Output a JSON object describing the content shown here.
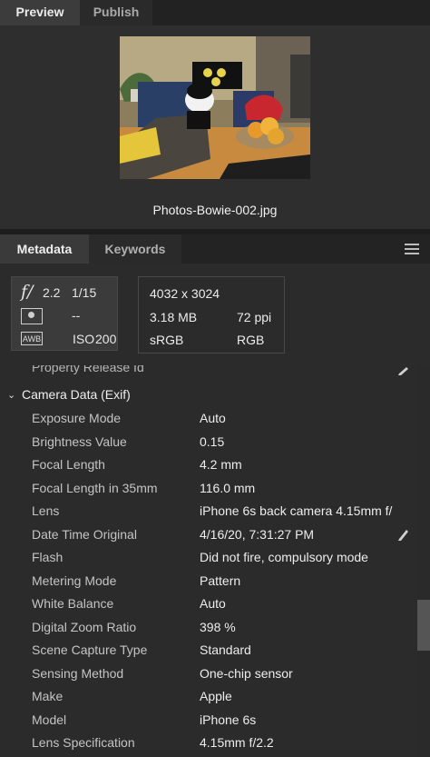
{
  "top_tabs": {
    "preview": "Preview",
    "publish": "Publish"
  },
  "preview": {
    "filename": "Photos-Bowie-002.jpg"
  },
  "meta_tabs": {
    "metadata": "Metadata",
    "keywords": "Keywords"
  },
  "icons": {
    "menu": "hamburger-menu-icon",
    "fstop": "f-stop-icon",
    "metering": "metering-mode-icon",
    "white_balance": "awb-icon",
    "edit": "pencil-icon",
    "chevron": "chevron-down-icon"
  },
  "summary": {
    "fstop_symbol": "f/",
    "fstop": "2.2",
    "shutter": "1/15",
    "metering": "--",
    "awb_label": "AWB",
    "iso_label": "ISO",
    "iso": "200",
    "dimensions": "4032 x 3024",
    "file_size": "3.18 MB",
    "resolution": "72 ppi",
    "color_space_1": "sRGB",
    "color_space_2": "RGB"
  },
  "partial_row": "Property Release Id",
  "section": {
    "chevron": "⌄",
    "label": "Camera Data (Exif)"
  },
  "rows": [
    {
      "label": "Exposure Mode",
      "value": "Auto"
    },
    {
      "label": "Brightness Value",
      "value": "0.15"
    },
    {
      "label": "Focal Length",
      "value": "4.2 mm"
    },
    {
      "label": "Focal Length in 35mm",
      "value": "116.0 mm"
    },
    {
      "label": "Lens",
      "value": "iPhone 6s back camera 4.15mm f/"
    },
    {
      "label": "Date Time Original",
      "value": "4/16/20, 7:31:27 PM"
    },
    {
      "label": "Flash",
      "value": "Did not fire, compulsory mode"
    },
    {
      "label": "Metering Mode",
      "value": "Pattern"
    },
    {
      "label": "White Balance",
      "value": "Auto"
    },
    {
      "label": "Digital Zoom Ratio",
      "value": "398 %"
    },
    {
      "label": "Scene Capture Type",
      "value": "Standard"
    },
    {
      "label": "Sensing Method",
      "value": "One-chip sensor"
    },
    {
      "label": "Make",
      "value": "Apple"
    },
    {
      "label": "Model",
      "value": "iPhone 6s"
    },
    {
      "label": "Lens Specification",
      "value": "4.15mm f/2.2"
    }
  ]
}
